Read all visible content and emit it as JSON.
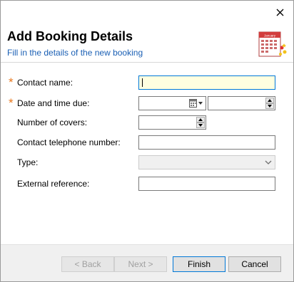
{
  "dialog": {
    "title": "Add Booking Details",
    "subtitle": "Fill in the details of the new booking",
    "header_icon": "calendar-icon",
    "calendar_icon_text": "January",
    "close_icon": "close-icon"
  },
  "form": {
    "contact_name": {
      "label": "Contact name:",
      "required": true,
      "value": ""
    },
    "date_time_due": {
      "label": "Date and time due:",
      "required": true,
      "date_value": "",
      "time_value": ""
    },
    "number_of_covers": {
      "label": "Number of covers:",
      "value": ""
    },
    "contact_telephone": {
      "label": "Contact telephone number:",
      "value": ""
    },
    "type": {
      "label": "Type:",
      "value": "",
      "enabled": false
    },
    "external_reference": {
      "label": "External reference:",
      "value": ""
    }
  },
  "buttons": {
    "back": "< Back",
    "next": "Next >",
    "finish": "Finish",
    "cancel": "Cancel"
  },
  "colors": {
    "required_star": "#e8781e",
    "subtitle": "#1a5fb4",
    "focused_field_bg": "#ffffe0"
  }
}
